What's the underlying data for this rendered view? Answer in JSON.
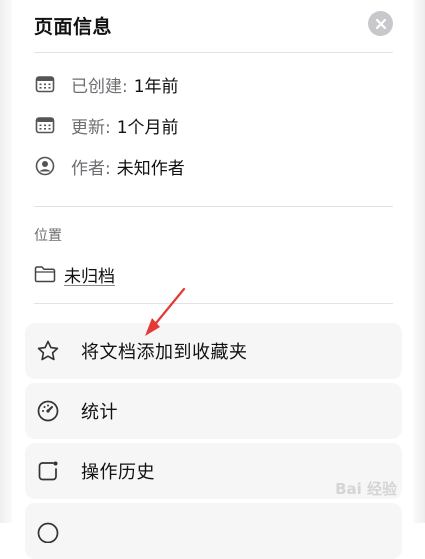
{
  "panel": {
    "title": "页面信息",
    "close_icon": "close-icon"
  },
  "info": {
    "created_label": "已创建:",
    "created_value": "1年前",
    "updated_label": "更新:",
    "updated_value": "1个月前",
    "author_label": "作者:",
    "author_value": "未知作者"
  },
  "location": {
    "section_label": "位置",
    "value": "未归档"
  },
  "actions": [
    {
      "label": "将文档添加到收藏夹",
      "icon": "star-icon"
    },
    {
      "label": "统计",
      "icon": "gauge-icon"
    },
    {
      "label": "操作历史",
      "icon": "history-icon"
    }
  ],
  "annotation": {
    "arrow_color": "#e53935"
  },
  "watermark": {
    "text": "Bai 经验"
  },
  "colors": {
    "close_bg": "#c8c8cc",
    "action_bg": "#f6f6f7",
    "muted_text": "#6e6e73"
  }
}
